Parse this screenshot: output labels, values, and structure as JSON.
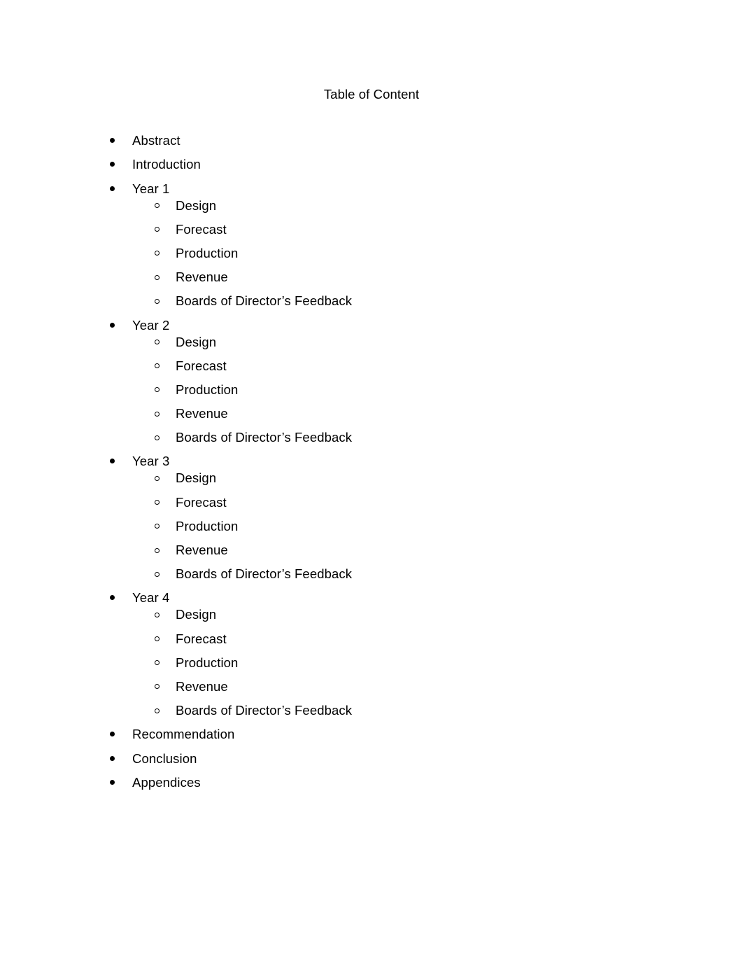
{
  "document": {
    "title": "Table of Content",
    "background_color": "#ffffff",
    "text_color": "#000000",
    "bullet_level1_glyph": "filled-circle",
    "bullet_level2_glyph": "hollow-circle"
  },
  "toc": {
    "entries": [
      {
        "label": "Abstract",
        "children": []
      },
      {
        "label": "Introduction",
        "children": []
      },
      {
        "label": "Year 1",
        "children": [
          {
            "label": "Design"
          },
          {
            "label": "Forecast"
          },
          {
            "label": "Production"
          },
          {
            "label": "Revenue"
          },
          {
            "label": "Boards of Director’s Feedback"
          }
        ]
      },
      {
        "label": "Year 2",
        "children": [
          {
            "label": "Design"
          },
          {
            "label": "Forecast"
          },
          {
            "label": "Production"
          },
          {
            "label": "Revenue"
          },
          {
            "label": "Boards of Director’s Feedback"
          }
        ]
      },
      {
        "label": "Year 3",
        "children": [
          {
            "label": "Design"
          },
          {
            "label": "Forecast"
          },
          {
            "label": "Production"
          },
          {
            "label": "Revenue"
          },
          {
            "label": "Boards of Director’s Feedback"
          }
        ]
      },
      {
        "label": "Year 4",
        "children": [
          {
            "label": "Design"
          },
          {
            "label": "Forecast"
          },
          {
            "label": "Production"
          },
          {
            "label": "Revenue"
          },
          {
            "label": "Boards of Director’s Feedback"
          }
        ]
      },
      {
        "label": "Recommendation",
        "children": []
      },
      {
        "label": "Conclusion",
        "children": []
      },
      {
        "label": "Appendices",
        "children": []
      }
    ]
  }
}
